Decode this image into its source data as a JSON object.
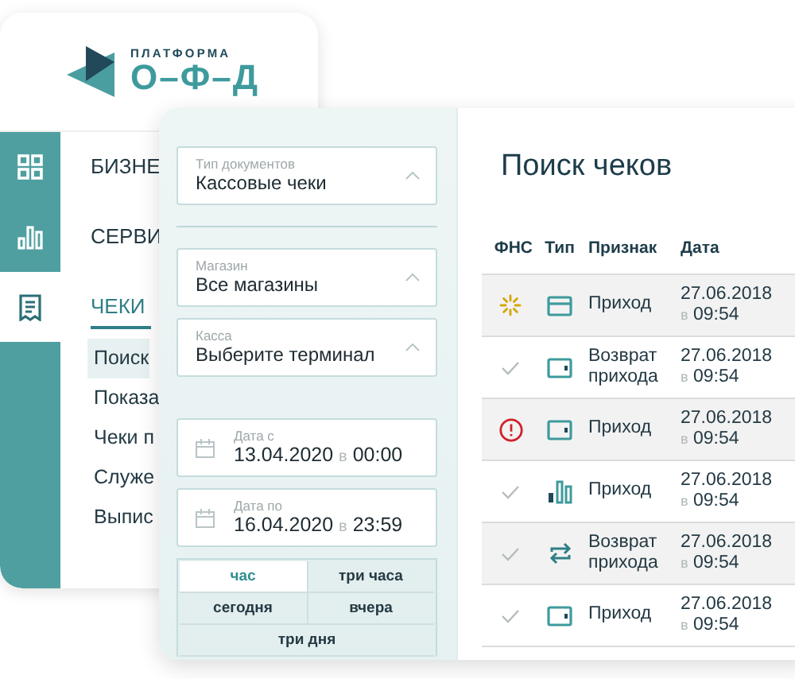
{
  "logo": {
    "top": "ПЛАТФОРМА",
    "bottom": "О–Ф–Д"
  },
  "nav_icons": [
    {
      "kind": "grid",
      "selected": false
    },
    {
      "kind": "bars",
      "selected": false
    },
    {
      "kind": "receipt",
      "selected": true
    }
  ],
  "menu": [
    {
      "label": "БИЗНЕ",
      "selected": false
    },
    {
      "label": "СЕРВИ",
      "selected": false
    },
    {
      "label": "ЧЕКИ",
      "selected": true
    }
  ],
  "submenu": [
    {
      "label": "Поиск",
      "selected": true
    },
    {
      "label": "Показа",
      "selected": false
    },
    {
      "label": "Чеки п",
      "selected": false
    },
    {
      "label": "Служе",
      "selected": false
    },
    {
      "label": "Выпис",
      "selected": false
    }
  ],
  "filter_groups": [
    [
      {
        "label": "Тип документов",
        "value": "Кассовые чеки"
      }
    ],
    [
      {
        "label": "Магазин",
        "value": "Все магазины"
      },
      {
        "label": "Касса",
        "value": "Выберите терминал"
      }
    ]
  ],
  "dates": [
    {
      "label": "Дата с",
      "date": "13.04.2020",
      "sep": "в",
      "time": "00:00"
    },
    {
      "label": "Дата по",
      "date": "16.04.2020",
      "sep": "в",
      "time": "23:59"
    }
  ],
  "periods": [
    [
      {
        "label": "час",
        "selected": true
      },
      {
        "label": "три часа",
        "selected": false
      }
    ],
    [
      {
        "label": "сегодня",
        "selected": false
      },
      {
        "label": "вчера",
        "selected": false
      }
    ],
    [
      {
        "label": "три дня",
        "selected": false
      }
    ]
  ],
  "results": {
    "title": "Поиск чеков",
    "columns": [
      "ФНС",
      "Тип",
      "Признак",
      "Дата"
    ],
    "rows": [
      {
        "status": {
          "kind": "pending"
        },
        "type": {
          "kind": "card"
        },
        "sign": "Приход",
        "date": "27.06.2018",
        "sep": "в",
        "time": "09:54"
      },
      {
        "status": {
          "kind": "ok"
        },
        "type": {
          "kind": "wallet"
        },
        "sign": "Возврат прихода",
        "date": "27.06.2018",
        "sep": "в",
        "time": "09:54"
      },
      {
        "status": {
          "kind": "error"
        },
        "type": {
          "kind": "wallet"
        },
        "sign": "Приход",
        "date": "27.06.2018",
        "sep": "в",
        "time": "09:54"
      },
      {
        "status": {
          "kind": "ok"
        },
        "type": {
          "kind": "bars"
        },
        "sign": "Приход",
        "date": "27.06.2018",
        "sep": "в",
        "time": "09:54"
      },
      {
        "status": {
          "kind": "ok"
        },
        "type": {
          "kind": "exchange"
        },
        "sign": "Возврат прихода",
        "date": "27.06.2018",
        "sep": "в",
        "time": "09:54"
      },
      {
        "status": {
          "kind": "ok"
        },
        "type": {
          "kind": "wallet"
        },
        "sign": "Приход",
        "date": "27.06.2018",
        "sep": "в",
        "time": "09:54"
      }
    ]
  }
}
